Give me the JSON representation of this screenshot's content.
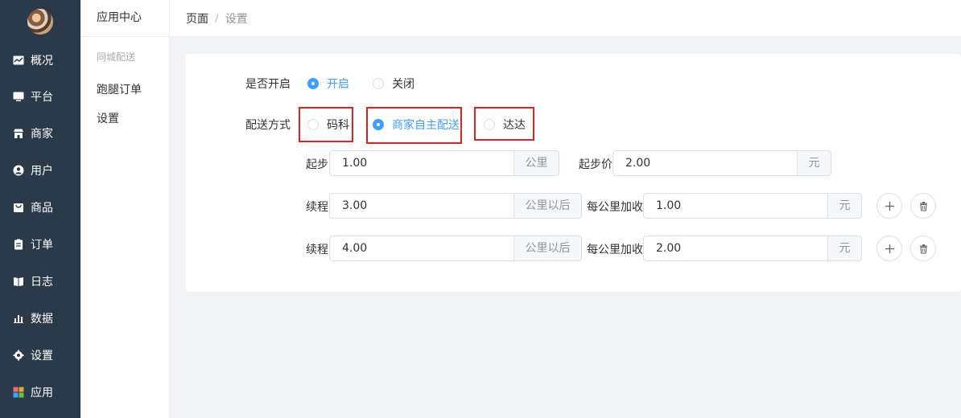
{
  "sidebar": {
    "items": [
      {
        "label": "概况",
        "icon": "chart-icon"
      },
      {
        "label": "平台",
        "icon": "monitor-icon"
      },
      {
        "label": "商家",
        "icon": "store-icon"
      },
      {
        "label": "用户",
        "icon": "user-icon"
      },
      {
        "label": "商品",
        "icon": "bag-icon"
      },
      {
        "label": "订单",
        "icon": "clipboard-icon"
      },
      {
        "label": "日志",
        "icon": "book-icon"
      },
      {
        "label": "数据",
        "icon": "bar-chart-icon"
      },
      {
        "label": "设置",
        "icon": "gear-icon"
      },
      {
        "label": "应用",
        "icon": "apps-icon"
      }
    ]
  },
  "subnav": {
    "title": "应用中心",
    "group": "同城配送",
    "links": [
      "跑腿订单",
      "设置"
    ]
  },
  "breadcrumb": [
    "页面",
    "设置"
  ],
  "breadcrumb_separator": "/",
  "form": {
    "enable_label": "是否开启",
    "enable_options": [
      {
        "label": "开启",
        "checked": true
      },
      {
        "label": "关闭",
        "checked": false
      }
    ],
    "method_label": "配送方式",
    "method_options": [
      {
        "label": "码科",
        "checked": false
      },
      {
        "label": "商家自主配送",
        "checked": true
      },
      {
        "label": "达达",
        "checked": false
      }
    ],
    "start": {
      "distance_label": "起步",
      "distance_value": "1.00",
      "distance_unit": "公里",
      "price_label": "起步价",
      "price_value": "2.00",
      "price_unit": "元"
    },
    "rows": [
      {
        "label": "续程",
        "value": "3.00",
        "unit": "公里以后",
        "per_label": "每公里加收",
        "per_value": "1.00",
        "per_unit": "元"
      },
      {
        "label": "续程",
        "value": "4.00",
        "unit": "公里以后",
        "per_label": "每公里加收",
        "per_value": "2.00",
        "per_unit": "元"
      }
    ]
  },
  "colors": {
    "sidebar_bg": "#2b3a4a",
    "accent": "#409eff",
    "highlight_box": "#e02020"
  }
}
